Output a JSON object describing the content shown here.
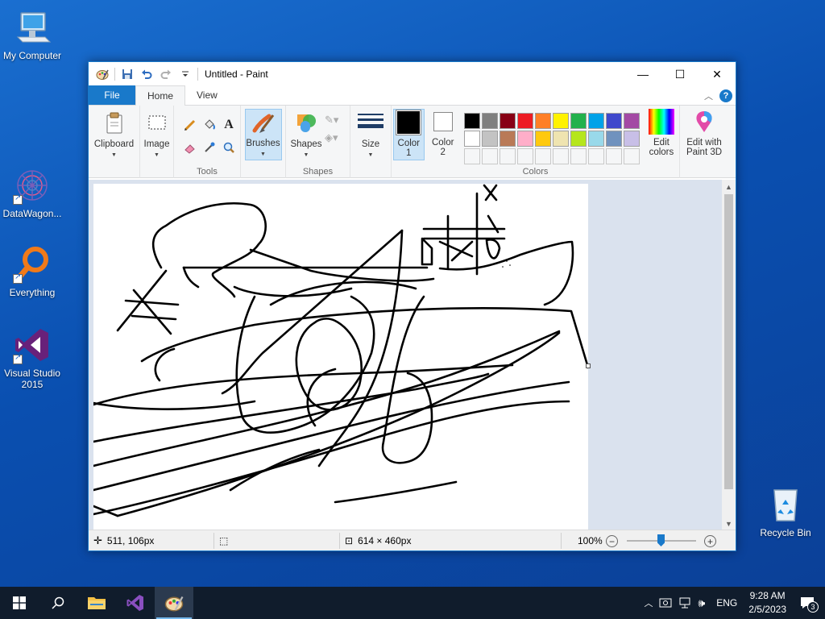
{
  "desktop": {
    "icons": [
      {
        "label": "My Computer"
      },
      {
        "label": "DataWagon..."
      },
      {
        "label": "Everything"
      },
      {
        "label": "Visual Studio 2015"
      },
      {
        "label": "Recycle Bin"
      }
    ]
  },
  "window": {
    "title": "Untitled - Paint",
    "controls": {
      "minimize": "—",
      "maximize": "☐",
      "close": "✕"
    }
  },
  "tabs": {
    "file": "File",
    "home": "Home",
    "view": "View"
  },
  "ribbon": {
    "clipboard": {
      "label": "Clipboard"
    },
    "image": {
      "label": "Image"
    },
    "tools": {
      "label": "Tools"
    },
    "brushes": {
      "label": "Brushes"
    },
    "shapes": {
      "button": "Shapes",
      "label": "Shapes"
    },
    "size": {
      "label": "Size"
    },
    "color1": {
      "line1": "Color",
      "line2": "1",
      "value": "#000000"
    },
    "color2": {
      "line1": "Color",
      "line2": "2",
      "value": "#ffffff"
    },
    "palette": [
      "#000000",
      "#7f7f7f",
      "#880015",
      "#ed1c24",
      "#ff7f27",
      "#fff200",
      "#22b14c",
      "#00a2e8",
      "#3f48cc",
      "#a349a4",
      "#ffffff",
      "#c3c3c3",
      "#b97a57",
      "#ffaec9",
      "#ffc90e",
      "#efe4b0",
      "#b5e61d",
      "#99d9ea",
      "#7092be",
      "#c8bfe7"
    ],
    "colors_label": "Colors",
    "edit_colors": {
      "line1": "Edit",
      "line2": "colors"
    },
    "paint3d": {
      "line1": "Edit with",
      "line2": "Paint 3D"
    }
  },
  "status": {
    "cursor_pos": "511, 106px",
    "image_size": "614 × 460px",
    "zoom": "100%",
    "zoom_percent": 100
  },
  "taskbar": {
    "time": "9:28 AM",
    "date": "2/5/2023",
    "lang": "ENG",
    "notification_count": "3"
  }
}
